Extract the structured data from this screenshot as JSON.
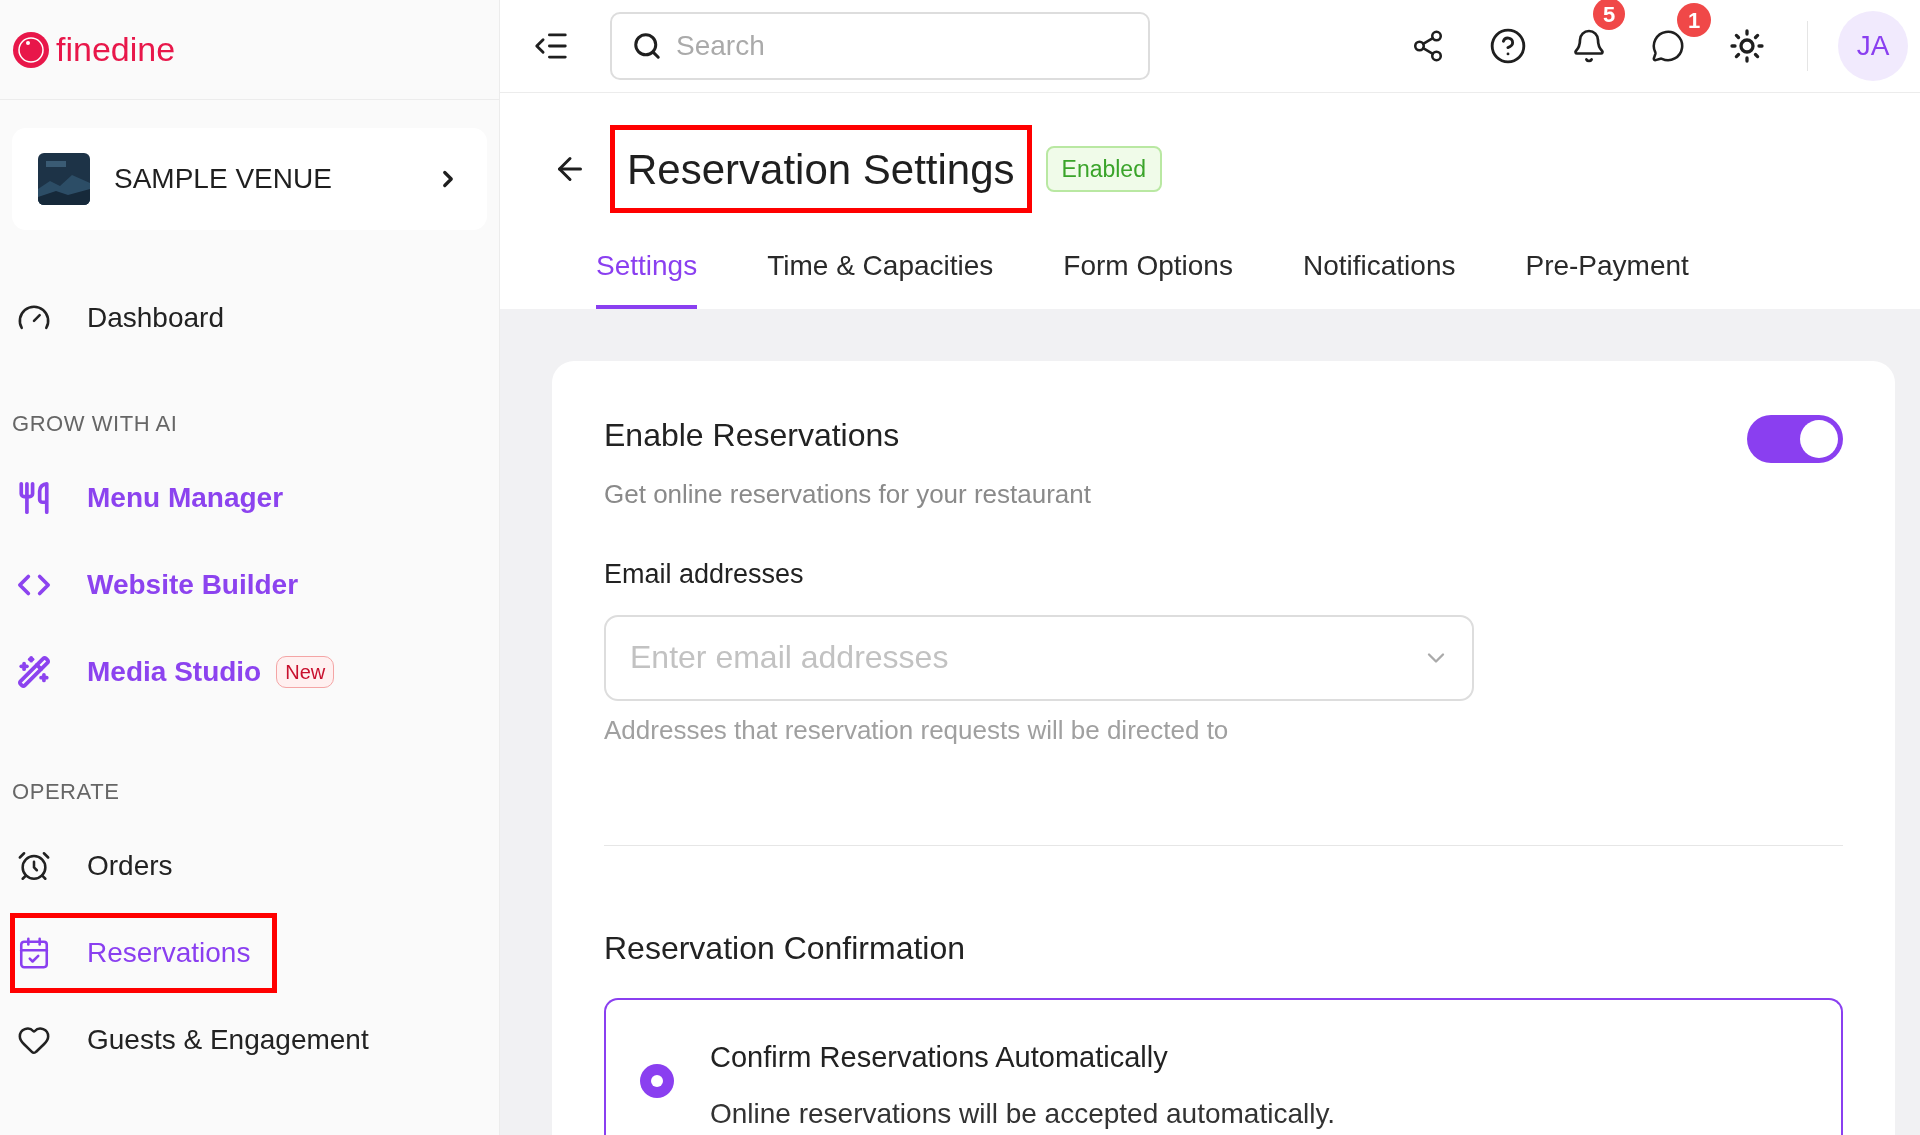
{
  "brand": {
    "name": "finedine"
  },
  "venue": {
    "name": "SAMPLE VENUE"
  },
  "sidebar": {
    "sections": [
      {
        "items": [
          {
            "label": "Dashboard",
            "accent": false,
            "selected": false,
            "highlighted": false
          }
        ]
      },
      {
        "heading": "GROW WITH AI",
        "items": [
          {
            "label": "Menu Manager",
            "accent": true,
            "selected": false,
            "highlighted": false
          },
          {
            "label": "Website Builder",
            "accent": true,
            "selected": false,
            "highlighted": false
          },
          {
            "label": "Media Studio",
            "accent": true,
            "selected": false,
            "highlighted": false,
            "badge": "New"
          }
        ]
      },
      {
        "heading": "OPERATE",
        "items": [
          {
            "label": "Orders",
            "accent": false,
            "selected": false,
            "highlighted": false
          },
          {
            "label": "Reservations",
            "accent": false,
            "selected": true,
            "highlighted": true
          },
          {
            "label": "Guests & Engagement",
            "accent": false,
            "selected": false,
            "highlighted": false
          }
        ]
      }
    ]
  },
  "topbar": {
    "search": {
      "placeholder": "Search"
    },
    "notification_count": "5",
    "message_count": "1",
    "avatar": "JA"
  },
  "page": {
    "title": "Reservation Settings",
    "title_highlighted": true,
    "status": "Enabled",
    "tabs": [
      {
        "label": "Settings",
        "selected": true
      },
      {
        "label": "Time & Capacities",
        "selected": false
      },
      {
        "label": "Form Options",
        "selected": false
      },
      {
        "label": "Notifications",
        "selected": false
      },
      {
        "label": "Pre-Payment",
        "selected": false
      }
    ]
  },
  "settings": {
    "enable": {
      "title": "Enable Reservations",
      "description": "Get online reservations for your restaurant",
      "on": true
    },
    "email": {
      "label": "Email addresses",
      "placeholder": "Enter email addresses",
      "help": "Addresses that reservation requests will be directed to"
    },
    "confirmation": {
      "title": "Reservation Confirmation",
      "options": [
        {
          "title": "Confirm Reservations Automatically",
          "description": "Online reservations will be accepted automatically.",
          "selected": true
        }
      ]
    }
  }
}
